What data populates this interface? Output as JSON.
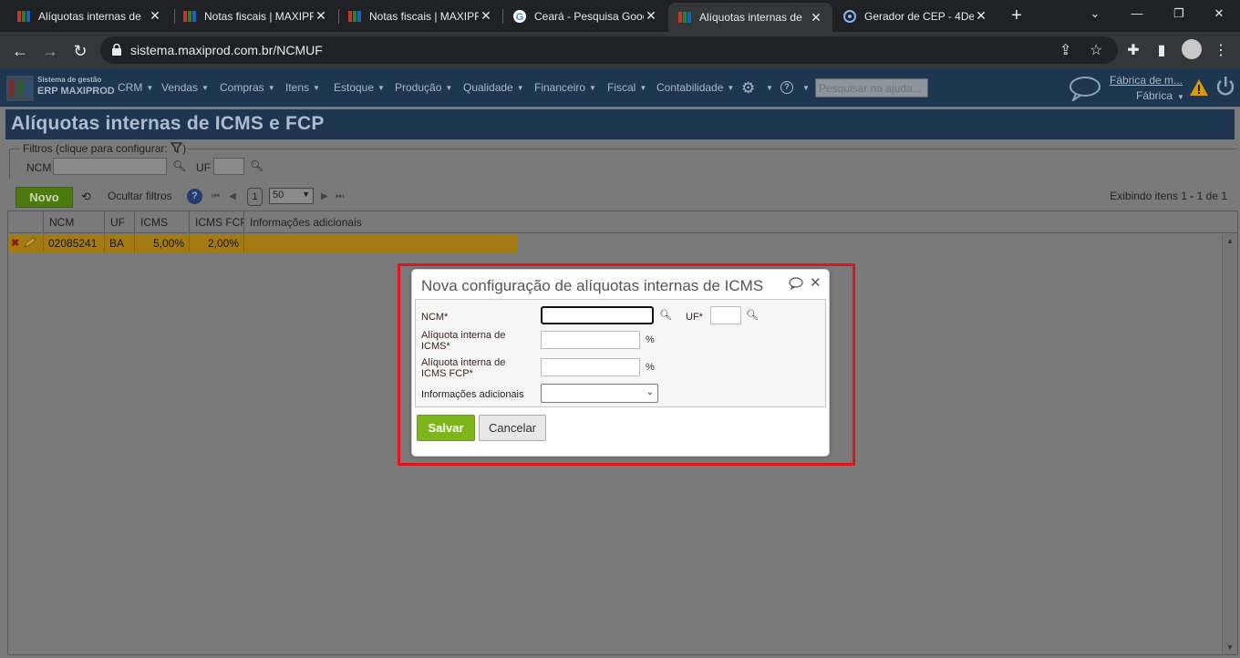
{
  "browser": {
    "tabs": [
      {
        "title": "Alíquotas internas de",
        "active": false
      },
      {
        "title": "Notas fiscais | MAXIPR",
        "active": false
      },
      {
        "title": "Notas fiscais | MAXIPR",
        "active": false
      },
      {
        "title": "Ceará - Pesquisa Goog",
        "active": false
      },
      {
        "title": "Alíquotas internas de",
        "active": true
      },
      {
        "title": "Gerador de CEP - 4De",
        "active": false
      }
    ],
    "url": "sistema.maxiprod.com.br/NCMUF"
  },
  "app": {
    "logo_sub": "Sistema de gestão",
    "logo_main": "ERP MAXIPROD",
    "menu": [
      "CRM",
      "Vendas",
      "Compras",
      "Itens",
      "Estoque",
      "Produção",
      "Qualidade",
      "Financeiro",
      "Fiscal",
      "Contabilidade"
    ],
    "search_placeholder": "Pesquisar na ajuda...",
    "company_link": "Fábrica de m...",
    "company_sub": "Fábrica"
  },
  "page": {
    "title": "Alíquotas internas de ICMS e FCP",
    "filters_legend": "Filtros (clique para configurar:",
    "filters_legend_end": ")",
    "filter_ncm_label": "NCM",
    "filter_uf_label": "UF",
    "btn_new": "Novo",
    "hide_filters": "Ocultar filtros",
    "page_number": "1",
    "page_size": "50",
    "showing": "Exibindo itens 1 - 1 de 1"
  },
  "grid": {
    "columns": [
      "NCM",
      "UF",
      "ICMS",
      "ICMS FCP",
      "Informações adicionais"
    ],
    "rows": [
      {
        "ncm": "02085241",
        "uf": "BA",
        "icms": "5,00%",
        "icms_fcp": "2,00%",
        "info": ""
      }
    ]
  },
  "dialog": {
    "title": "Nova configuração de alíquotas internas de ICMS",
    "ncm_label": "NCM*",
    "ncm_value": "",
    "uf_label": "UF*",
    "uf_value": "",
    "icms_label_1": "Alíquota interna de",
    "icms_label_2": "ICMS*",
    "icms_value": "",
    "fcp_label_1": "Alíquota interna de",
    "fcp_label_2": "ICMS FCP*",
    "fcp_value": "",
    "pct": "%",
    "info_label": "Informações adicionais",
    "info_value": "",
    "save": "Salvar",
    "cancel": "Cancelar"
  },
  "colors": {
    "nav_bg": "#1e3650",
    "selected_row": "#a47a12",
    "save_button": "#7fb51c",
    "highlight_frame": "#e3141b"
  }
}
